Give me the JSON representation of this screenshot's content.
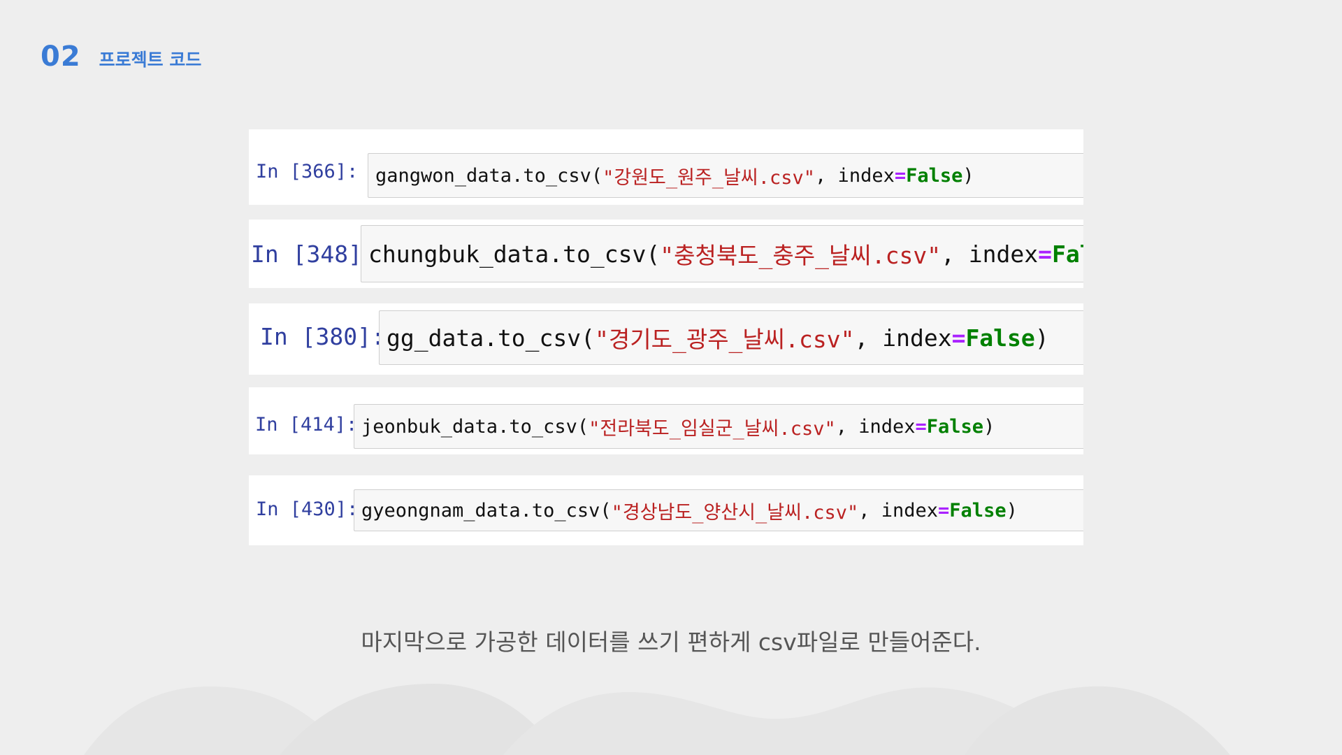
{
  "header": {
    "number": "02",
    "title": "프로젝트 코드"
  },
  "cells": [
    {
      "prompt": "In [366]:",
      "var": "gangwon_data.to_csv(",
      "string": "\"강원도_원주_날씨.csv\"",
      "mid": ", index ",
      "op": "=",
      "space": " ",
      "kw": "False",
      "close": ")"
    },
    {
      "prompt": "In [348]:",
      "var": "chungbuk_data.to_csv(",
      "string": "\"충청북도_충주_날씨.csv\"",
      "mid": ", index ",
      "op": "=",
      "space": " ",
      "kw": "False",
      "close": ")"
    },
    {
      "prompt": "In [380]:",
      "var": "gg_data.to_csv(",
      "string": "\"경기도_광주_날씨.csv\"",
      "mid": ", index ",
      "op": "=",
      "space": " ",
      "kw": "False",
      "close": ")"
    },
    {
      "prompt": "In [414]:",
      "var": "jeonbuk_data.to_csv(",
      "string": "\"전라북도_임실군_날씨.csv\"",
      "mid": ", index ",
      "op": "=",
      "space": " ",
      "kw": "False",
      "close": ")"
    },
    {
      "prompt": "In [430]:",
      "var": "gyeongnam_data.to_csv(",
      "string": "\"경상남도_양산시_날씨.csv\"",
      "mid": ", index ",
      "op": "=",
      "space": " ",
      "kw": "False",
      "close": ")"
    }
  ],
  "caption": "마지막으로 가공한 데이터를 쓰기 편하게 csv파일로 만들어준다.",
  "colors": {
    "accent": "#3a7bd5",
    "prompt": "#303f9f",
    "string": "#ba2121",
    "operator": "#aa22ff",
    "keyword": "#008000"
  }
}
